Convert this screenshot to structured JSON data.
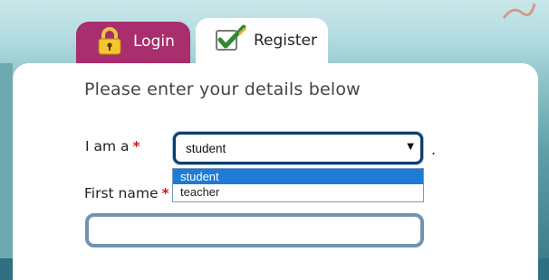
{
  "tabs": {
    "login": {
      "label": "Login"
    },
    "register": {
      "label": "Register"
    }
  },
  "form": {
    "intro": "Please enter your details below",
    "role": {
      "label": "I am a",
      "required_marker": "*",
      "selected": "student",
      "options": [
        "student",
        "teacher"
      ],
      "suffix": "."
    },
    "first_name": {
      "label": "First name",
      "required_marker": "*",
      "value": ""
    }
  },
  "icons": {
    "login": "lock-icon",
    "register": "checkmark-icon",
    "select_arrow": "dropdown-arrow-icon"
  },
  "colors": {
    "login_tab": "#a92e6d",
    "register_tab": "#ffffff",
    "select_border": "#0f3d6e",
    "option_highlight": "#1e7bd6",
    "required": "#d21b1b"
  }
}
